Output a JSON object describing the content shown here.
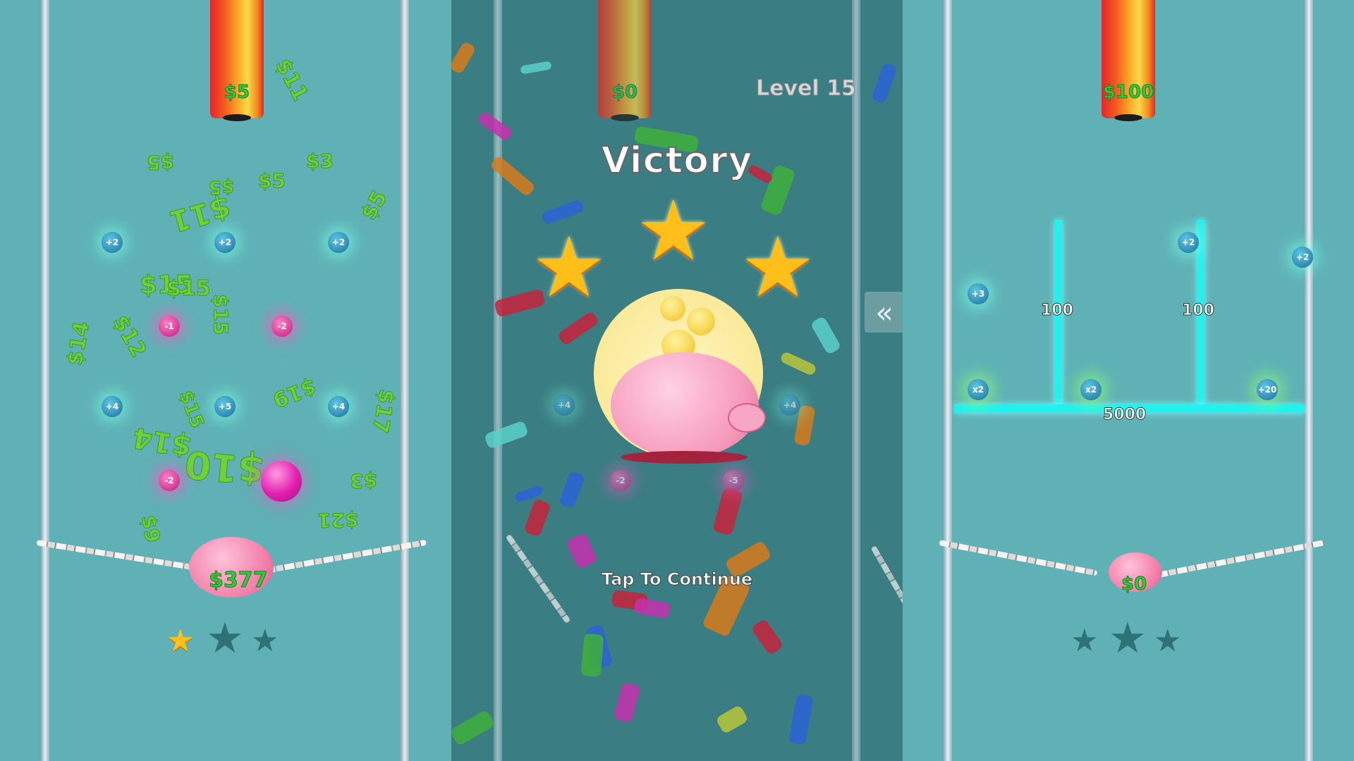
{
  "left_panel": {
    "pipe_label": "$5",
    "floating_money": [
      "$11",
      "$3",
      "$5",
      "$5",
      "$5",
      "$11",
      "$5",
      "$15",
      "$15",
      "$15",
      "$14",
      "$12",
      "$19",
      "$15",
      "$17",
      "$14",
      "$10",
      "$3",
      "$9",
      "$21"
    ],
    "pegs": [
      "+2",
      "+2",
      "+2",
      "-1",
      "-2",
      "+4",
      "+5",
      "+4",
      "-2"
    ],
    "pig_amount": "$377",
    "stars_earned": 1,
    "stars_total": 3
  },
  "center_panel": {
    "pipe_label": "$0",
    "level_label": "Level 15",
    "victory_title": "Victory",
    "stars_earned": 3,
    "pegs": [
      "+4",
      "+4",
      "-2",
      "-5"
    ],
    "tap_to_continue": "Tap To Continue",
    "rewind_icon": "double-chevron-left-icon"
  },
  "right_panel": {
    "pipe_label": "$100",
    "pegs": [
      "+3",
      "+2",
      "+2",
      "x2",
      "x2",
      "+20"
    ],
    "bar_labels": [
      "100",
      "100",
      "5000"
    ],
    "pig_amount": "$0",
    "stars_earned": 0,
    "stars_total": 3
  },
  "colors": {
    "background": "#5fb1b5",
    "money_green": "#6ed13a",
    "star_gold": "#ffc21c",
    "bar_cyan": "#24f0ee"
  }
}
